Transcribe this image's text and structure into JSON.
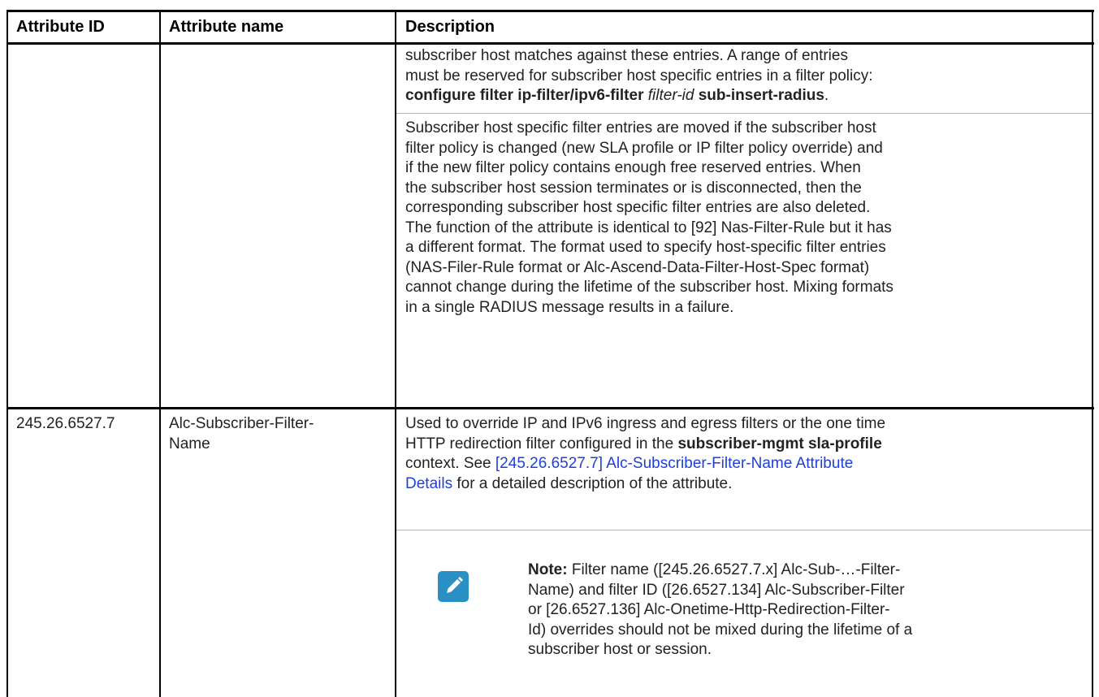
{
  "header": {
    "col1": "Attribute ID",
    "col2": "Attribute name",
    "col3": "Description"
  },
  "row1": {
    "para1_line1": "subscriber host matches against these entries. A range of entries",
    "para1_line2": "must be reserved for subscriber host specific entries in a filter policy:",
    "para1_cmd": "configure filter ip-filter/ipv6-filter",
    "para1_var": "filter-id",
    "para1_cmd2": "sub-insert-radius",
    "para1_end": ".",
    "para2_lines": [
      "Subscriber host specific filter entries are moved if the subscriber host",
      "filter policy is changed (new SLA profile or IP filter policy override) and",
      "if the new filter policy contains enough free reserved entries. When",
      "the subscriber host session terminates or is disconnected, then the",
      "corresponding subscriber host specific filter entries are also deleted.",
      "The function of the attribute is identical to [92] Nas-Filter-Rule but it has",
      "a different format. The format used to specify host-specific filter entries",
      "(NAS-Filer-Rule format or Alc-Ascend-Data-Filter-Host-Spec format)",
      "cannot change during the lifetime of the subscriber host. Mixing formats",
      "in a single RADIUS message results in a failure."
    ]
  },
  "row2": {
    "id": "245.26.6527.7",
    "name_line1": "Alc-Subscriber-Filter-",
    "name_line2": "Name",
    "desc_line1": "Used to override IP and IPv6 ingress and egress filters or the one time",
    "desc_line2_a": "HTTP redirection filter configured in the",
    "desc_line2_b": "subscriber-mgmt sla-profile",
    "desc_line3_a": "context. See",
    "desc_link_1": "[245.26.6527.7] Alc-Subscriber-Filter-Name Attribute",
    "desc_link_2": "Details",
    "desc_line4_rest": "for a detailed description of the attribute.",
    "note_label": "Note:",
    "note_line1_rest": "Filter name ([245.26.6527.7.x] Alc-Sub-…-Filter-",
    "note_lines": [
      "Name) and filter ID ([26.6527.134] Alc-Subscriber-Filter",
      "or [26.6527.136] Alc-Onetime-Http-Redirection-Filter-",
      "Id) overrides should not be mixed during the lifetime of a",
      "subscriber host or session."
    ],
    "note_icon": "note-pencil-icon"
  },
  "colors": {
    "header_bg": "#ffffff",
    "link": "#1f3fd6",
    "note_icon_bg": "#2a8fc2"
  }
}
